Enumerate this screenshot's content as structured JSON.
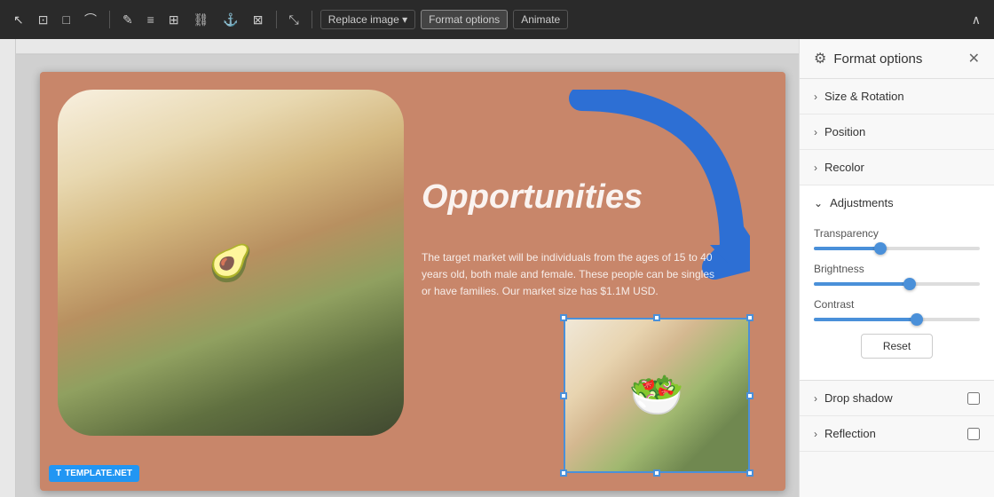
{
  "toolbar": {
    "buttons": [
      "replace_image_label",
      "format_options_label",
      "animate_label"
    ],
    "replace_image_label": "Replace image ▾",
    "format_options_label": "Format options",
    "animate_label": "Animate"
  },
  "slide": {
    "title": "Opportunities",
    "body_text": "The target market will be individuals from the ages of 15 to 40 years old, both male and female. These people can be singles or have families. Our market size has $1.1M USD.",
    "template_logo_t": "T",
    "template_logo_text": "TEMPLATE.NET"
  },
  "panel": {
    "title": "Format options",
    "sections": {
      "size_rotation": "Size & Rotation",
      "position": "Position",
      "recolor": "Recolor",
      "adjustments": "Adjustments",
      "drop_shadow": "Drop shadow",
      "reflection": "Reflection"
    },
    "adjustments": {
      "transparency_label": "Transparency",
      "transparency_value": 40,
      "brightness_label": "Brightness",
      "brightness_value": 58,
      "contrast_label": "Contrast",
      "contrast_value": 62,
      "reset_label": "Reset"
    }
  }
}
